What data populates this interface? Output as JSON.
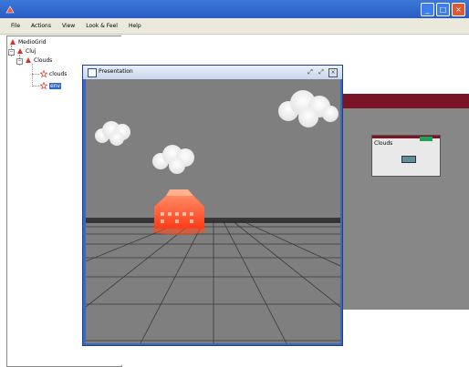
{
  "window": {
    "title": "",
    "controls": [
      "minimize",
      "maximize",
      "close"
    ]
  },
  "menubar": {
    "items": [
      "File",
      "Actions",
      "View",
      "Look & Feel",
      "Help"
    ]
  },
  "tree": {
    "root": "MedioGrid",
    "nodes": [
      {
        "label": "Cluj",
        "level": 1,
        "expanded": true
      },
      {
        "label": "Clouds",
        "level": 2,
        "expanded": true
      },
      {
        "label": "clouds",
        "level": 3
      },
      {
        "label": "env",
        "level": 3,
        "selected": true
      }
    ]
  },
  "presentation": {
    "title": "Presentation",
    "buttons": [
      "undock",
      "maximize",
      "close"
    ]
  },
  "background_window": {
    "node_title": "Clouds"
  },
  "colors": {
    "title_bar": "#2a5cc4",
    "menubar": "#ebe9dc",
    "selection": "#316ac5",
    "scene_background": "#7f7f7f",
    "accent_dark_red": "#7a1527"
  }
}
